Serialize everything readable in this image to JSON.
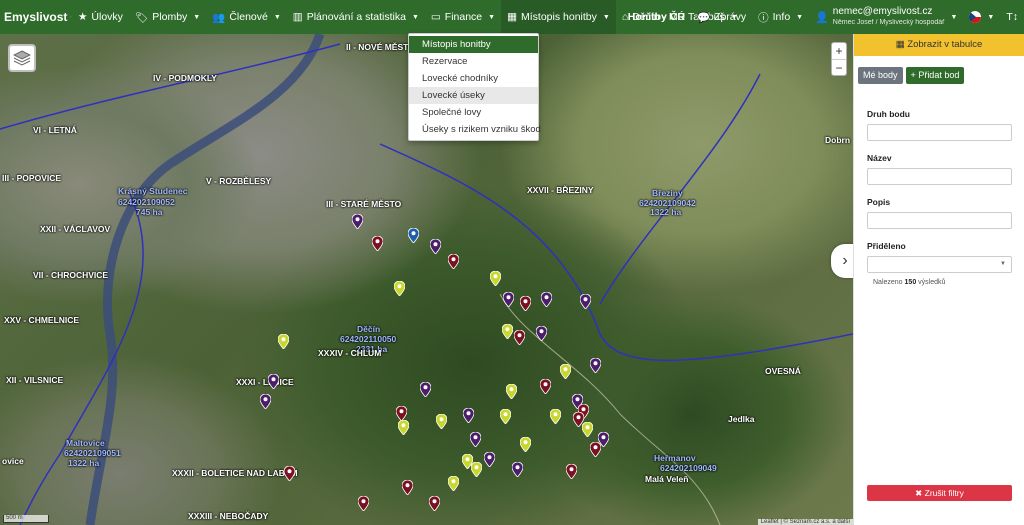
{
  "navbar": {
    "brand": "Emyslivost",
    "items": [
      {
        "label": "Úlovky",
        "icon": "star-icon"
      },
      {
        "label": "Plomby",
        "icon": "tag-icon"
      },
      {
        "label": "Členové",
        "icon": "users-icon"
      },
      {
        "label": "Plánování a statistika",
        "icon": "chart-icon"
      },
      {
        "label": "Finance",
        "icon": "money-icon"
      },
      {
        "label": "Místopis honitby",
        "icon": "map-icon"
      },
      {
        "label": "Děčín - MÚ Tambuš",
        "icon": "home-icon"
      }
    ],
    "honitby": "Honitby ČR",
    "zpravy": "Zprávy",
    "info": "Info",
    "user_email": "nemec@emyslivost.cz",
    "user_sub": "Němec Josef / Myslivecký hospodář",
    "text_size": "T↕"
  },
  "dropdown": {
    "items": [
      "Místopis honitby",
      "Rezervace",
      "Lovecké chodníky",
      "Lovecké úseky",
      "Společné lovy",
      "Úseky s rizikem vzniku škod"
    ]
  },
  "map": {
    "labels": [
      "II - NOVÉ MĚSTO",
      "IV - PODMOKLY",
      "VI - LETNÁ",
      "III - POPOVICE",
      "V - ROZBĚLESY",
      "Krásný Studenec",
      "624202109052",
      "745 ha",
      "XXII - VÁCLAVOV",
      "VII - CHROCHVICE",
      "XXV - CHMELNICE",
      "XII - VILSNICE",
      "III - STARÉ MĚSTO",
      "XXVII - BŘEZINY",
      "Březiny",
      "624202109042",
      "1322 ha",
      "Děčín",
      "624202110050",
      "2331 ha",
      "XXXIV - CHLUM",
      "XXXI - LEŠICE",
      "Maltovice",
      "624202109051",
      "1322 ha",
      "XXXII - BOLETICE NAD LABEM",
      "XXXIII - NEBOČADY",
      "OVESNÁ",
      "Heřmanov",
      "624202109049",
      "Malá Veleň",
      "Jedlka",
      "Dobrn",
      "ovice"
    ],
    "zoom_in": "+",
    "zoom_out": "−",
    "scale": "500 m",
    "attribution": "Leaflet | © Seznam.cz a.s. a další"
  },
  "panel": {
    "table_button": "Zobrazit v tabulce",
    "my_points": "Mé body",
    "add_point": "Přidat bod",
    "fields": {
      "type": "Druh bodu",
      "name": "Název",
      "description": "Popis",
      "assigned": "Přiděleno"
    },
    "result_prefix": "Nalezeno",
    "result_count": "150",
    "result_suffix": "výsledků",
    "clear_filters": "Zrušit filtry"
  },
  "colors": {
    "navbar": "#2f6b2b",
    "accent_yellow": "#f2c12e",
    "danger": "#dc3545",
    "pin_purple": "#4b1d6a",
    "pin_red": "#7a1020",
    "pin_yellow": "#c8d62e",
    "pin_blue": "#1f5fa8"
  }
}
